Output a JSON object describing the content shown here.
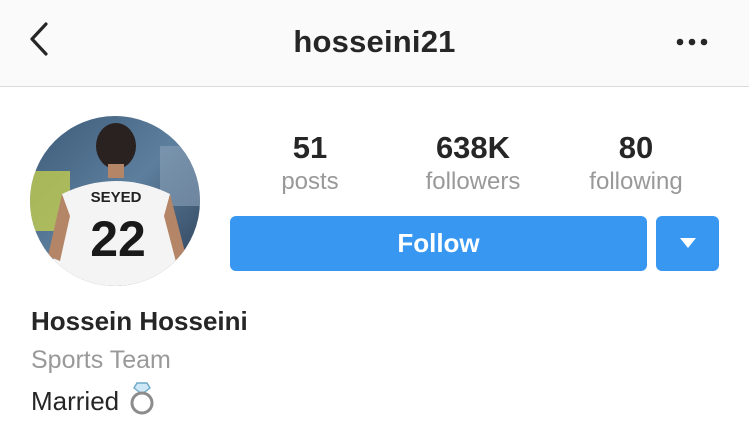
{
  "header": {
    "title": "hosseini21",
    "back_icon": "chevron-left-icon",
    "more_icon": "ellipsis-icon"
  },
  "profile": {
    "avatar": {
      "jersey_name": "SEYED",
      "jersey_number": "22"
    },
    "stats": [
      {
        "value": "51",
        "label": "posts"
      },
      {
        "value": "638K",
        "label": "followers"
      },
      {
        "value": "80",
        "label": "following"
      }
    ],
    "follow_label": "Follow",
    "dropdown_icon": "triangle-down-icon",
    "name": "Hossein Hosseini",
    "category": "Sports Team",
    "bio": "Married",
    "bio_icon": "ring-icon"
  },
  "colors": {
    "accent": "#3897f0",
    "muted_text": "#999999",
    "primary_text": "#262626"
  }
}
